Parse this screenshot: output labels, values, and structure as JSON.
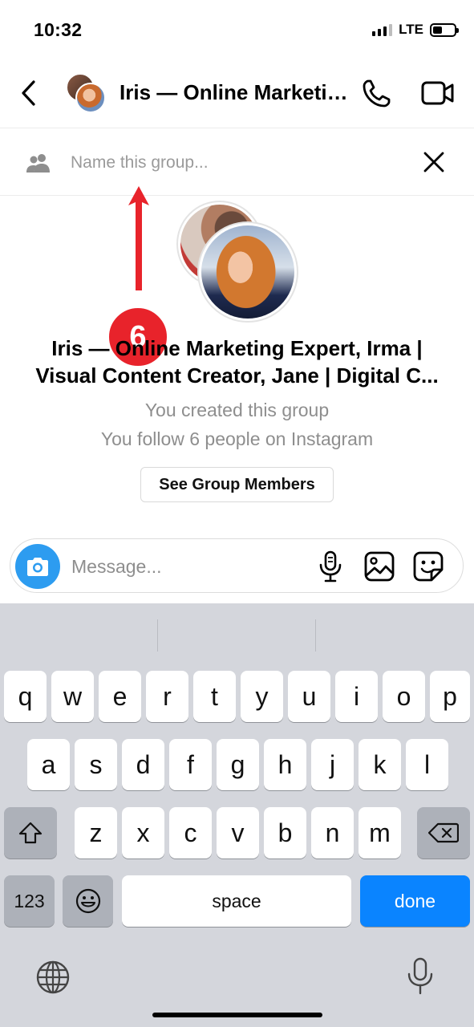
{
  "status_bar": {
    "time": "10:32",
    "network": "LTE"
  },
  "header": {
    "title": "Iris — Online Marketing Expert, Irma | Visual Content Creator, Jane | Digital C..."
  },
  "group_name": {
    "placeholder": "Name this group..."
  },
  "annotation": {
    "step_number": "6"
  },
  "group_info": {
    "title_line1": "Iris — Online Marketing Expert, Irma |",
    "title_line2": "Visual Content Creator, Jane | Digital C...",
    "created_text": "You created this group",
    "follow_text": "You follow 6 people on Instagram",
    "see_members_label": "See Group Members"
  },
  "composer": {
    "placeholder": "Message..."
  },
  "keyboard": {
    "row1": [
      "q",
      "w",
      "e",
      "r",
      "t",
      "y",
      "u",
      "i",
      "o",
      "p"
    ],
    "row2": [
      "a",
      "s",
      "d",
      "f",
      "g",
      "h",
      "j",
      "k",
      "l"
    ],
    "row3": [
      "z",
      "x",
      "c",
      "v",
      "b",
      "n",
      "m"
    ],
    "numbers_label": "123",
    "space_label": "space",
    "done_label": "done"
  },
  "colors": {
    "accent": "#0a84ff",
    "camera": "#2d9cf0",
    "annotation": "#e8232b"
  },
  "icons": [
    "back-icon",
    "phone-icon",
    "video-icon",
    "group-icon",
    "close-icon",
    "camera-icon",
    "mic-icon",
    "gallery-icon",
    "sticker-icon",
    "shift-icon",
    "backspace-icon",
    "emoji-icon",
    "globe-icon",
    "dictation-icon"
  ]
}
